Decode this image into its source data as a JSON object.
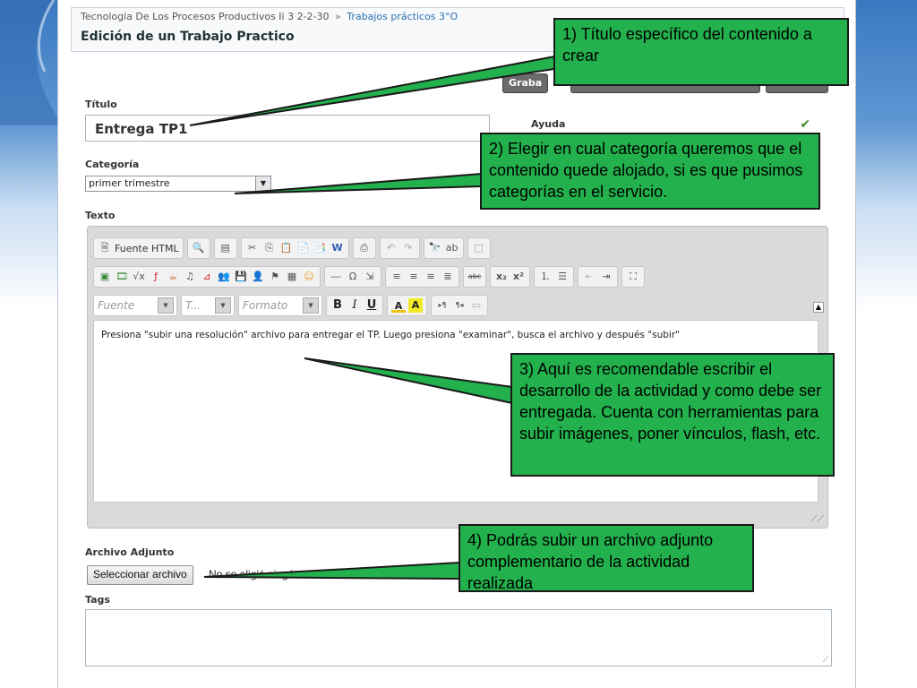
{
  "breadcrumb": {
    "course": "Tecnologia De Los Procesos Productivos Ii 3 2-2-30",
    "separator": "»",
    "section": "Trabajos prácticos 3°O"
  },
  "page_title": "Edición de un Trabajo Practico",
  "toolbar": {
    "save_label": "Graba"
  },
  "form": {
    "title_label": "Título",
    "title_value": "Entrega TP1",
    "help_label": "Ayuda",
    "category_label": "Categoría",
    "category_value": "primer trimestre",
    "text_label": "Texto",
    "attachment_label": "Archivo Adjunto",
    "file_button": "Seleccionar archivo",
    "file_status": "No se eligió ningún archivo",
    "tags_label": "Tags"
  },
  "editor": {
    "source_button": "Fuente HTML",
    "font_combo": "Fuente",
    "size_combo": "T...",
    "format_combo": "Formato",
    "bold": "B",
    "italic": "I",
    "underline": "U",
    "subscript": "x₂",
    "superscript": "x²",
    "content": "Presiona \"subir una resolución\" archivo para entregar el TP. Luego presiona \"examinar\", busca el archivo y después \"subir\""
  },
  "callouts": {
    "c1": "1) Título específico del contenido a crear",
    "c2": "2) Elegir en cual categoría queremos que el contenido quede alojado, si es que pusimos categorías en el servicio.",
    "c3": "3) Aquí es recomendable escribir el desarrollo de la actividad y como debe ser entregada. Cuenta con herramientas para subir imágenes, poner vínculos, flash, etc.",
    "c4": "4) Podrás subir un archivo adjunto complementario de la actividad realizada"
  },
  "colors": {
    "callout_green": "#22b14c",
    "link_blue": "#2a6fb0"
  }
}
